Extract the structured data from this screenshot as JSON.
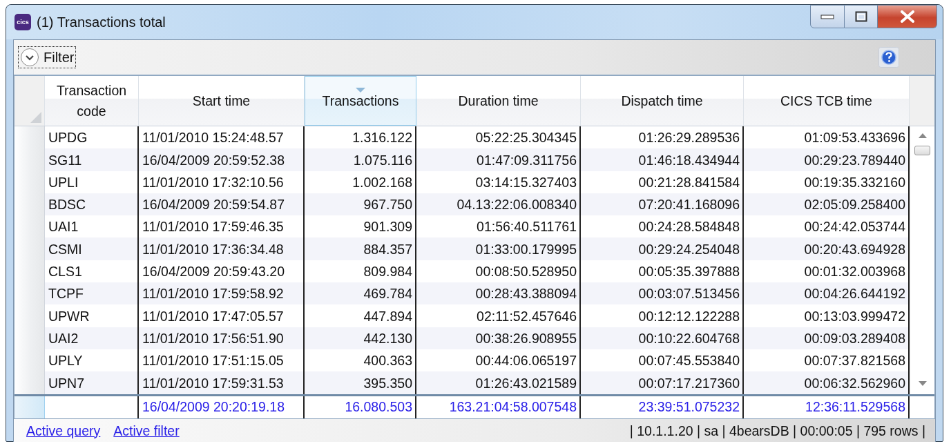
{
  "window": {
    "title": "(1) Transactions total",
    "icon_text": "cics"
  },
  "filter": {
    "label": "Filter",
    "expanded": false,
    "focused": true
  },
  "table": {
    "columns": [
      {
        "label": "Transaction code",
        "sorted": false
      },
      {
        "label": "Start time",
        "sorted": false
      },
      {
        "label": "Transactions",
        "sorted": true
      },
      {
        "label": "Duration time",
        "sorted": false
      },
      {
        "label": "Dispatch time",
        "sorted": false
      },
      {
        "label": "CICS TCB time",
        "sorted": false
      }
    ],
    "rows": [
      {
        "cells": [
          "UPDG",
          "11/01/2010 15:24:48.57",
          "1.316.122",
          "05:22:25.304345",
          "01:26:29.289536",
          "01:09:53.433696"
        ]
      },
      {
        "cells": [
          "SG11",
          "16/04/2009 20:59:52.38",
          "1.075.116",
          "01:47:09.311756",
          "01:46:18.434944",
          "00:29:23.789440"
        ]
      },
      {
        "cells": [
          "UPLI",
          "11/01/2010 17:32:10.56",
          "1.002.168",
          "03:14:15.327403",
          "00:21:28.841584",
          "00:19:35.332160"
        ]
      },
      {
        "cells": [
          "BDSC",
          "16/04/2009 20:59:54.87",
          "967.750",
          "04.13:22:06.008340",
          "07:20:41.168096",
          "02:05:09.258400"
        ]
      },
      {
        "cells": [
          "UAI1",
          "11/01/2010 17:59:46.35",
          "901.309",
          "01:56:40.511761",
          "00:24:28.584848",
          "00:24:42.053744"
        ]
      },
      {
        "cells": [
          "CSMI",
          "11/01/2010 17:36:34.48",
          "884.357",
          "01:33:00.179995",
          "00:29:24.254048",
          "00:20:43.694928"
        ]
      },
      {
        "cells": [
          "CLS1",
          "16/04/2009 20:59:43.20",
          "809.984",
          "00:08:50.528950",
          "00:05:35.397888",
          "00:01:32.003968"
        ]
      },
      {
        "cells": [
          "TCPF",
          "11/01/2010 17:59:58.92",
          "469.784",
          "00:28:43.388094",
          "00:03:07.513456",
          "00:04:26.644192"
        ]
      },
      {
        "cells": [
          "UPWR",
          "11/01/2010 17:47:05.57",
          "447.894",
          "02:11:52.457646",
          "00:12:12.122288",
          "00:13:03.999472"
        ]
      },
      {
        "cells": [
          "UAI2",
          "11/01/2010 17:56:51.90",
          "442.130",
          "00:38:26.908955",
          "00:10:22.604768",
          "00:09:03.289408"
        ]
      },
      {
        "cells": [
          "UPLY",
          "11/01/2010 17:51:15.05",
          "400.363",
          "00:44:06.065197",
          "00:07:45.553840",
          "00:07:37.821568"
        ]
      },
      {
        "cells": [
          "UPN7",
          "11/01/2010 17:59:31.53",
          "395.350",
          "01:26:43.021589",
          "00:07:17.217360",
          "00:06:32.562960"
        ]
      }
    ],
    "totals": [
      "16/04/2009 20:20:19.18",
      "16.080.503",
      "163.21:04:58.007548",
      "23:39:51.075232",
      "12:36:11.529568"
    ]
  },
  "status_bar": {
    "links": [
      "Active query",
      "Active filter"
    ],
    "info": "| 10.1.1.20 | sa | 4bearsDB | 00:00:05 | 795 rows |"
  }
}
